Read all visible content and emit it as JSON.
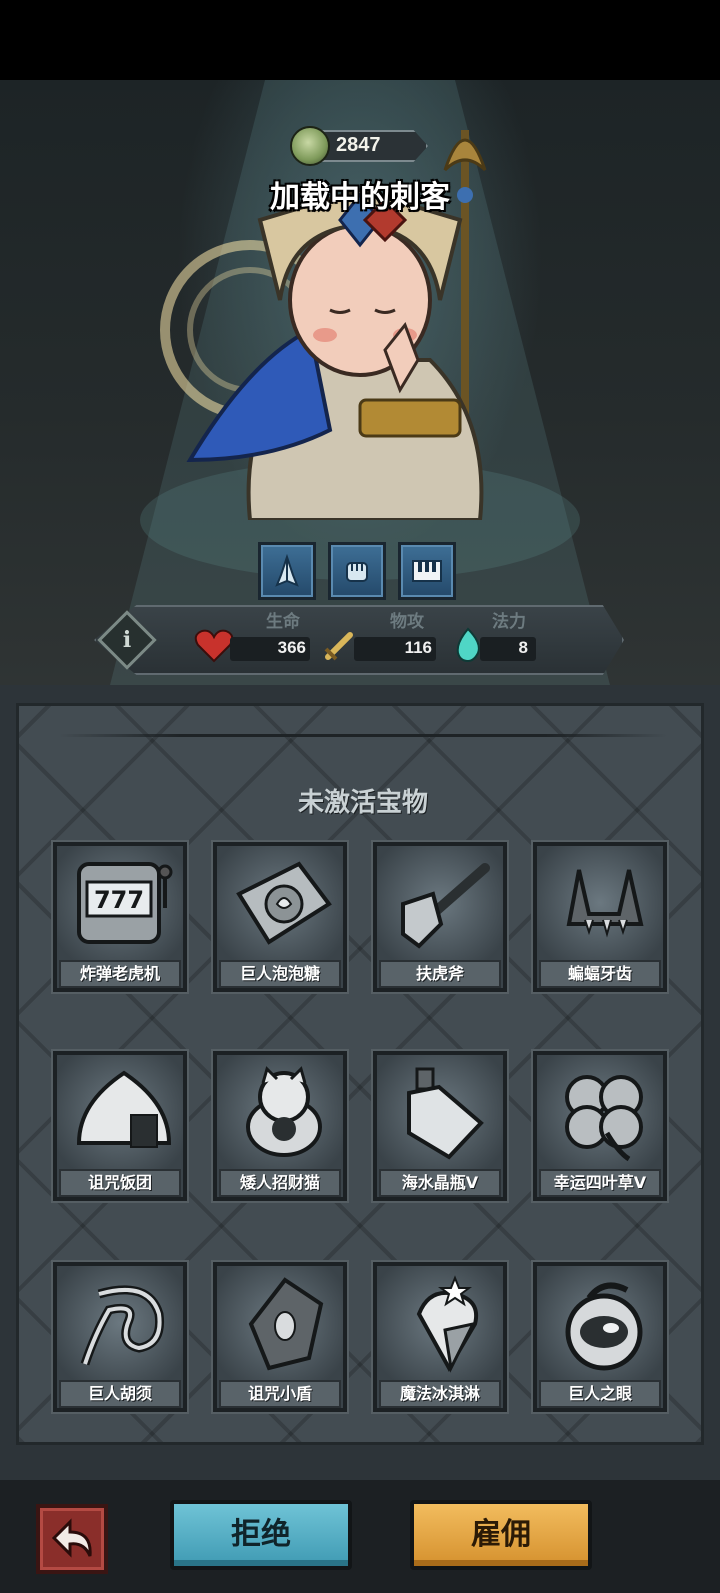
{
  "hero": {
    "power": "2847",
    "name": "加载中的刺客"
  },
  "skills": [
    "praying-hands-icon",
    "fist-icon",
    "piano-keys-icon"
  ],
  "stats": {
    "hp_label": "生命",
    "hp_value": "366",
    "atk_label": "物攻",
    "atk_value": "116",
    "mp_label": "法力",
    "mp_value": "8"
  },
  "panel": {
    "title": "未激活宝物",
    "items": [
      {
        "name": "炸弹老虎机",
        "icon": "slot-machine-icon"
      },
      {
        "name": "巨人泡泡糖",
        "icon": "bubblegum-pack-icon"
      },
      {
        "name": "扶虎斧",
        "icon": "axe-icon"
      },
      {
        "name": "蝙蝠牙齿",
        "icon": "bat-fangs-icon"
      },
      {
        "name": "诅咒饭团",
        "icon": "rice-ball-icon"
      },
      {
        "name": "矮人招财猫",
        "icon": "lucky-cat-icon"
      },
      {
        "name": "海水晶瓶V",
        "icon": "crystal-bottle-icon"
      },
      {
        "name": "幸运四叶草V",
        "icon": "four-leaf-clover-icon"
      },
      {
        "name": "巨人胡须",
        "icon": "beard-icon"
      },
      {
        "name": "诅咒小盾",
        "icon": "small-shield-icon"
      },
      {
        "name": "魔法冰淇淋",
        "icon": "ice-cream-icon"
      },
      {
        "name": "巨人之眼",
        "icon": "giant-eye-icon"
      }
    ]
  },
  "actions": {
    "back_icon": "undo-arrow-icon",
    "reject_label": "拒绝",
    "hire_label": "雇佣"
  },
  "colors": {
    "reject": "#4fb0c8",
    "hire": "#e8a645",
    "back": "#8a2e2a",
    "panel": "#434c52"
  }
}
